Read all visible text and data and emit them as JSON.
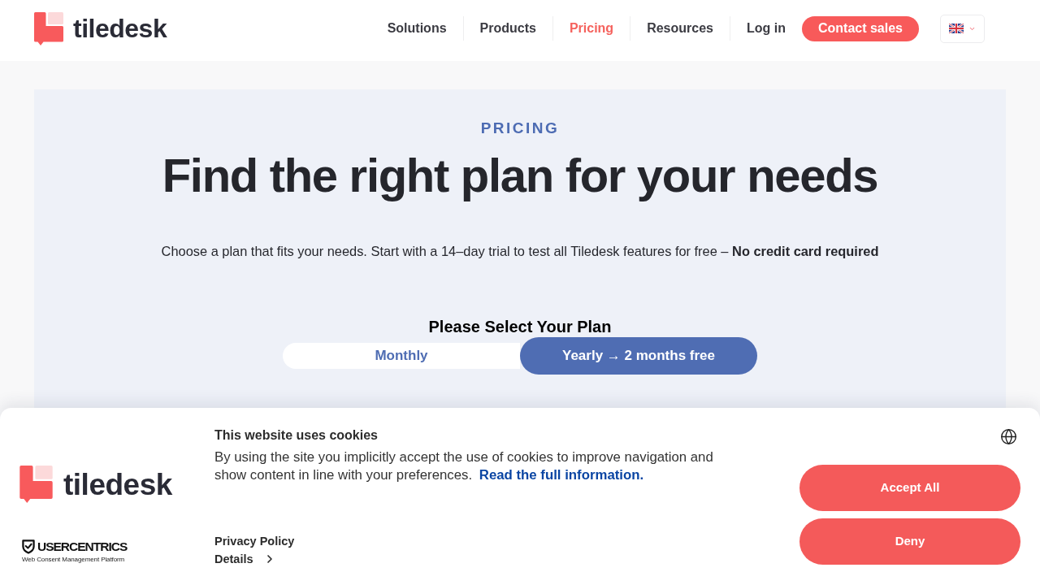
{
  "header": {
    "logo_text": "tiledesk",
    "nav": [
      {
        "label": "Solutions",
        "selected": false
      },
      {
        "label": "Products",
        "selected": false
      },
      {
        "label": "Pricing",
        "selected": true
      },
      {
        "label": "Resources",
        "selected": false
      },
      {
        "label": "Log in",
        "selected": false
      }
    ],
    "cta": "Contact sales"
  },
  "hero": {
    "eyebrow": "PRICING",
    "title": "Find the right plan for your needs",
    "subtitle": "Choose a plan that fits your needs. Start with a 14–day trial to test all Tiledesk features for free – **No credit card required**",
    "plan_heading": "Please Select Your Plan",
    "billing_options": [
      {
        "label": "Monthly",
        "selected": false
      },
      {
        "label": "Yearly → 2 months free",
        "selected": true
      }
    ]
  },
  "cookie_banner": {
    "logo_text": "tiledesk",
    "provider": {
      "name": "USERCENTRICS",
      "tagline": "Web Consent Management Platform"
    },
    "title": "This website uses cookies",
    "message": "By using the site you implicitly accept the use of cookies to improve navigation and show content in line with your preferences.",
    "link": "Read the full information.",
    "links": [
      {
        "label": "Privacy Policy",
        "kind": "plain"
      },
      {
        "label": "Details",
        "kind": "expand"
      }
    ],
    "buttons": [
      "Accept All",
      "Deny"
    ]
  }
}
